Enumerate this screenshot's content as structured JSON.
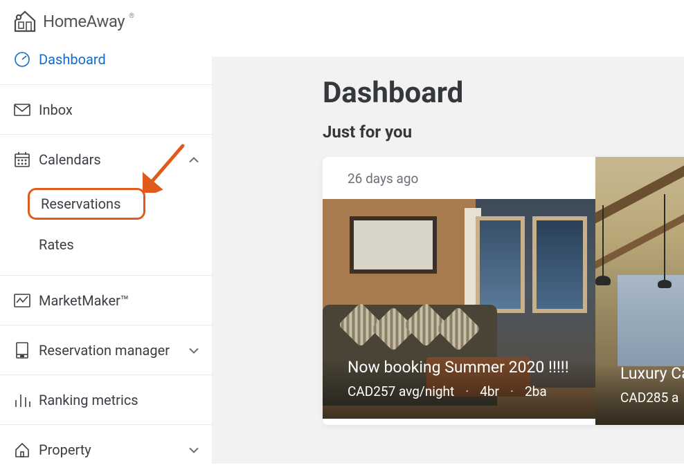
{
  "brand": {
    "name": "HomeAway"
  },
  "sidebar": {
    "dashboard": "Dashboard",
    "inbox": "Inbox",
    "calendars": "Calendars",
    "calendars_sub": {
      "reservations": "Reservations",
      "rates": "Rates"
    },
    "marketmaker": "MarketMaker™",
    "reservation_manager": "Reservation manager",
    "ranking_metrics": "Ranking metrics",
    "property": "Property"
  },
  "main": {
    "title": "Dashboard",
    "subtitle": "Just for you",
    "cards": [
      {
        "age": "26 days ago",
        "title": "Now booking Summer 2020 !!!!!",
        "price": "CAD257 avg/night",
        "br": "4br",
        "ba": "2ba"
      },
      {
        "title": "Luxury Ca",
        "price": "CAD285 a"
      }
    ]
  }
}
